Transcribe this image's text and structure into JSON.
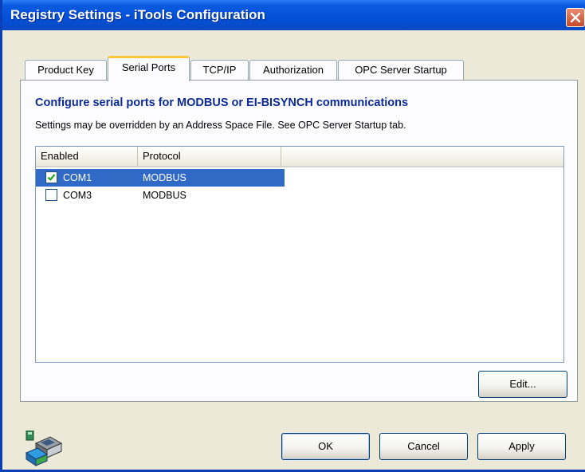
{
  "window": {
    "title": "Registry Settings - iTools Configuration"
  },
  "tabs": [
    {
      "label": "Product Key",
      "active": false
    },
    {
      "label": "Serial Ports",
      "active": true
    },
    {
      "label": "TCP/IP",
      "active": false
    },
    {
      "label": "Authorization",
      "active": false
    },
    {
      "label": "OPC Server Startup",
      "active": false
    }
  ],
  "panel": {
    "heading": "Configure serial ports for MODBUS or EI-BISYNCH communications",
    "subtext": "Settings may be overridden by an Address Space File.  See OPC Server Startup tab."
  },
  "listview": {
    "columns": [
      "Enabled",
      "Protocol"
    ],
    "rows": [
      {
        "port": "COM1",
        "protocol": "MODBUS",
        "enabled": true,
        "selected": true
      },
      {
        "port": "COM3",
        "protocol": "MODBUS",
        "enabled": false,
        "selected": false
      }
    ]
  },
  "buttons": {
    "edit": "Edit...",
    "ok": "OK",
    "cancel": "Cancel",
    "apply": "Apply"
  },
  "icons": {
    "close": "close-icon",
    "checkbox_checked": "checkmark-icon",
    "app": "network-computer-icon"
  },
  "colors": {
    "title_bar": "#0450d6",
    "dialog_bg": "#ece9d8",
    "heading": "#0b2a96",
    "selection": "#3169c6",
    "tab_highlight": "#ffc83c"
  }
}
